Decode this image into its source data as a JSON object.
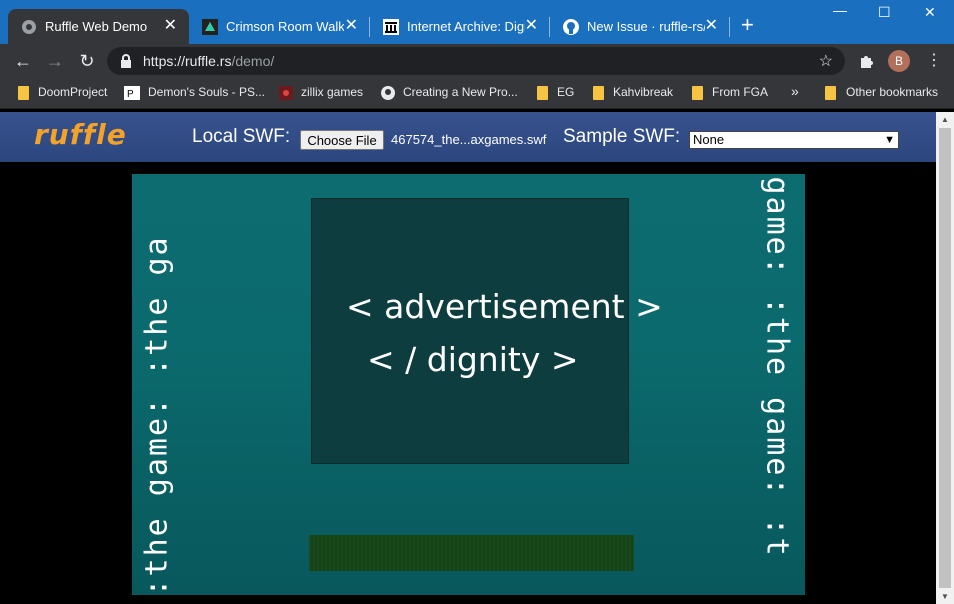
{
  "browser": {
    "tabs": [
      {
        "title": "Ruffle Web Demo",
        "active": true
      },
      {
        "title": "Crimson Room Walkth",
        "active": false
      },
      {
        "title": "Internet Archive: Digit",
        "active": false
      },
      {
        "title": "New Issue · ruffle-rs/r",
        "active": false
      }
    ],
    "new_tab": "+",
    "address": {
      "host": "https://ruffle.rs",
      "path": "/demo/"
    },
    "profile_initial": "B",
    "bookmarks": [
      "DoomProject",
      "Demon's Souls - PS...",
      "zillix games",
      "Creating a New Pro...",
      "EG",
      "Kahvibreak",
      "From FGA"
    ],
    "overflow": "»",
    "other_bookmarks": "Other bookmarks"
  },
  "ruffle": {
    "logo": "ruffle",
    "local_swf_label": "Local SWF:",
    "choose_file": "Choose File",
    "file_name": "467574_the...axgames.swf",
    "sample_swf_label": "Sample SWF:",
    "sample_selected": "None"
  },
  "game": {
    "ad_line1": "< advertisement >",
    "ad_line2": "< / dignity >",
    "left_text": ":the game: :the ga",
    "right_text": "game: :the game: :t"
  },
  "colors": {
    "tabstrip": "#1a6fbf",
    "chrome_dark": "#35363a",
    "ruffle_header": "#37528c",
    "logo": "#f4a22a",
    "game_bg": "#0d6c70"
  }
}
